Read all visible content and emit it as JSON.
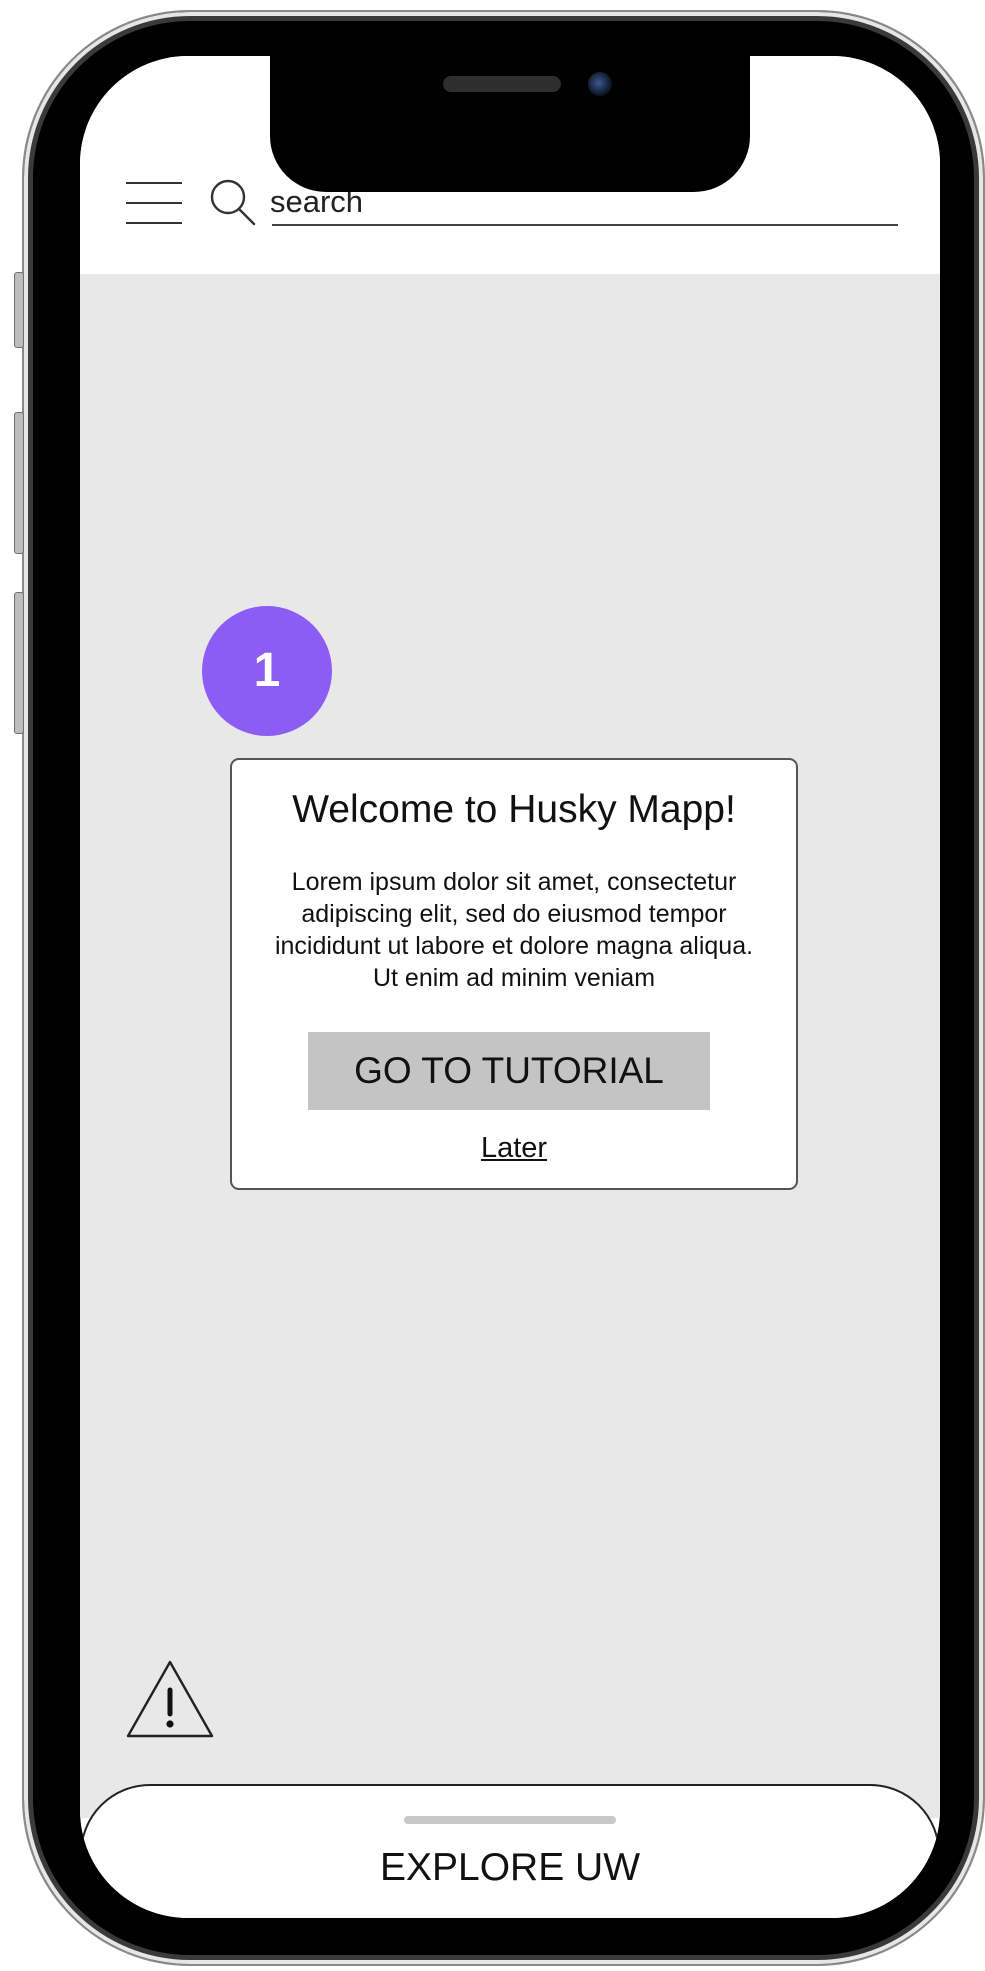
{
  "header": {
    "search_label": "search"
  },
  "onboarding": {
    "step_number": "1",
    "title": "Welcome to Husky Mapp!",
    "body": "Lorem ipsum dolor sit amet, consectetur adipiscing elit, sed do eiusmod tempor incididunt ut labore et dolore magna aliqua. Ut enim ad minim veniam",
    "primary_button": "GO TO TUTORIAL",
    "secondary_link": "Later"
  },
  "bottom_sheet": {
    "label": "EXPLORE UW"
  },
  "icons": {
    "menu": "menu-icon",
    "search": "search-icon",
    "warning": "warning-icon"
  },
  "colors": {
    "step_badge": "#8c5cf4",
    "map_background": "#e8e8e8",
    "primary_button": "#c4c4c4"
  }
}
